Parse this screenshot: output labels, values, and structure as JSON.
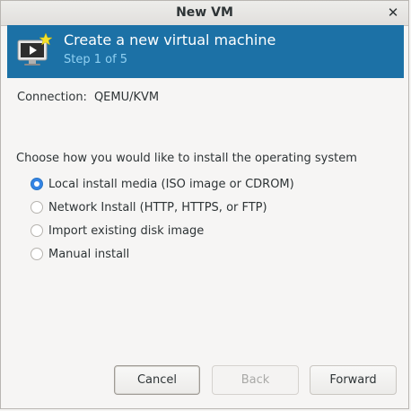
{
  "window": {
    "title": "New VM",
    "close_icon": "close-icon"
  },
  "header": {
    "icon": "virtual-machine-icon",
    "title": "Create a new virtual machine",
    "step": "Step 1 of 5",
    "background_color": "#1c71a6"
  },
  "connection": {
    "label": "Connection:",
    "value": "QEMU/KVM"
  },
  "install": {
    "prompt": "Choose how you would like to install the operating system",
    "options": [
      {
        "label": "Local install media (ISO image or CDROM)",
        "selected": true
      },
      {
        "label": "Network Install (HTTP, HTTPS, or FTP)",
        "selected": false
      },
      {
        "label": "Import existing disk image",
        "selected": false
      },
      {
        "label": "Manual install",
        "selected": false
      }
    ]
  },
  "buttons": {
    "cancel": "Cancel",
    "back": "Back",
    "forward": "Forward"
  },
  "accent_color": "#3584e4"
}
